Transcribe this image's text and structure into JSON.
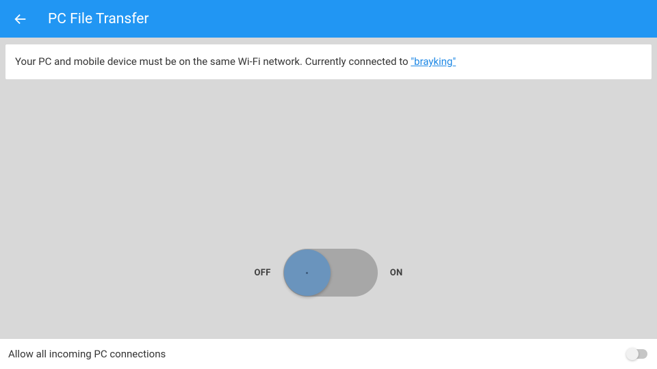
{
  "header": {
    "title": "PC File Transfer"
  },
  "info": {
    "prefix": "Your PC and mobile device must be on the same Wi-Fi network. Currently connected to ",
    "network_name": "\"brayking\""
  },
  "main_toggle": {
    "off_label": "OFF",
    "on_label": "ON",
    "state": "off"
  },
  "bottom": {
    "label": "Allow all incoming PC connections",
    "state": "off"
  },
  "colors": {
    "accent": "#2196f3",
    "knob": "#6a94bd"
  }
}
